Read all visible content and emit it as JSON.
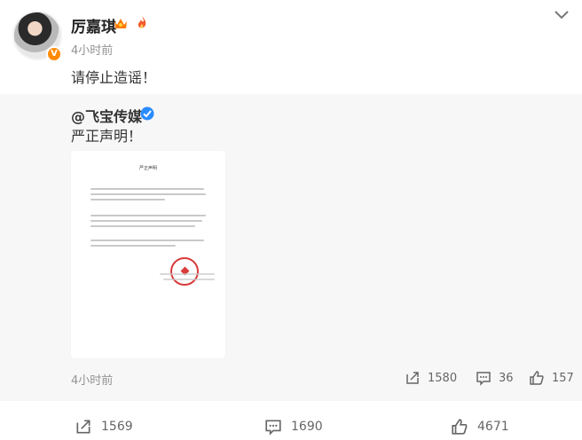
{
  "post": {
    "username": "厉嘉琪",
    "timestamp": "4小时前",
    "text": "请停止造谣！"
  },
  "repost": {
    "author": "@飞宝传媒",
    "text": "严正声明！",
    "timestamp": "4小时前",
    "document_title": "严正声明",
    "actions": {
      "share_count": "1580",
      "comment_count": "36",
      "like_count": "157"
    }
  },
  "actions": {
    "share_count": "1569",
    "comment_count": "1690",
    "like_count": "4671"
  },
  "icons": {
    "verified_color": "#2b8cff",
    "badge_color": "#ff8a00",
    "crown_color": "#ff7a00",
    "seal_color": "#d93a3a"
  }
}
